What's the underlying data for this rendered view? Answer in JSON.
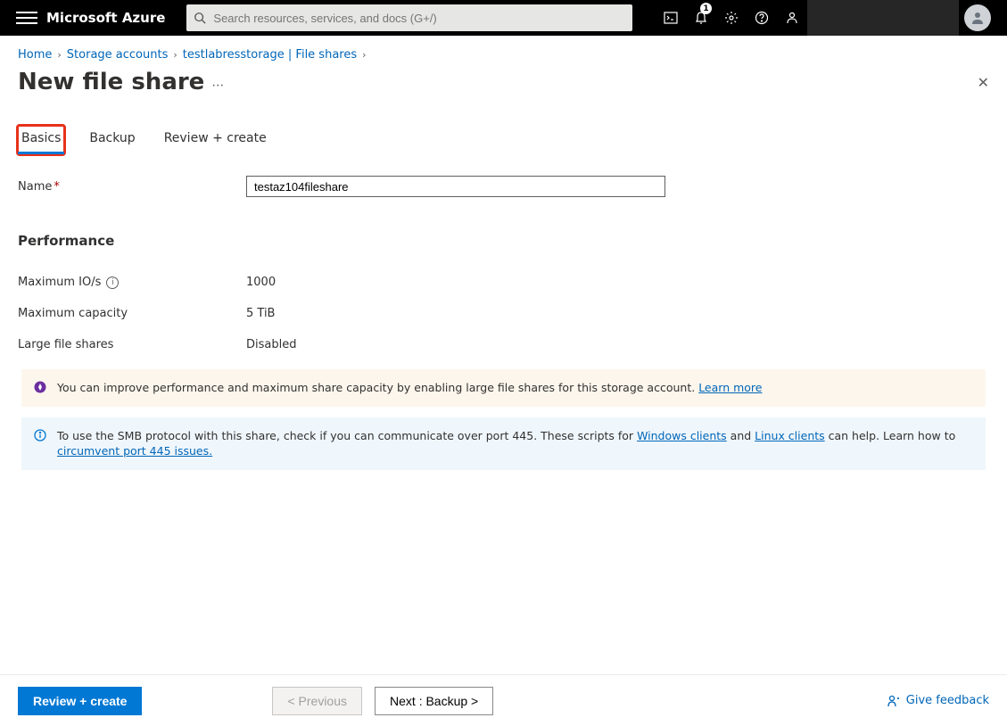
{
  "header": {
    "brand": "Microsoft Azure",
    "search_placeholder": "Search resources, services, and docs (G+/)",
    "notification_count": "1"
  },
  "breadcrumb": {
    "items": [
      "Home",
      "Storage accounts",
      "testlabresstorage | File shares"
    ]
  },
  "page": {
    "title": "New file share"
  },
  "tabs": {
    "basics": "Basics",
    "backup": "Backup",
    "review": "Review + create"
  },
  "form": {
    "name_label": "Name",
    "name_value": "testaz104fileshare"
  },
  "performance": {
    "heading": "Performance",
    "max_io_label": "Maximum IO/s",
    "max_io_value": "1000",
    "max_capacity_label": "Maximum capacity",
    "max_capacity_value": "5 TiB",
    "large_shares_label": "Large file shares",
    "large_shares_value": "Disabled"
  },
  "banners": {
    "upsell_text_1": "You can improve performance and maximum share capacity by enabling large file shares for this storage account. ",
    "upsell_link_1": "Learn more",
    "info_text_1": "To use the SMB protocol with this share, check if you can communicate over port 445. These scripts for ",
    "info_link_1": "Windows clients",
    "info_text_2": " and ",
    "info_link_2": "Linux clients",
    "info_text_3": " can help. Learn how to ",
    "info_link_3": "circumvent port 445 issues."
  },
  "footer": {
    "review": "Review + create",
    "previous": "< Previous",
    "next": "Next : Backup >",
    "feedback": "Give feedback"
  }
}
